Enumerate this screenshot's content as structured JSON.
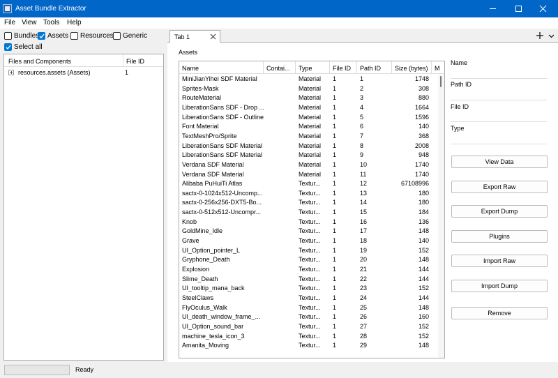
{
  "window": {
    "title": "Asset Bundle Extractor"
  },
  "menu": [
    "File",
    "View",
    "Tools",
    "Help"
  ],
  "filters": [
    {
      "label": "Bundles",
      "checked": false
    },
    {
      "label": "Assets",
      "checked": true
    },
    {
      "label": "Resources",
      "checked": false
    },
    {
      "label": "Generic",
      "checked": false
    }
  ],
  "select_all": {
    "label": "Select all",
    "checked": true
  },
  "left_panel": {
    "columns": [
      "Files and Components",
      "File ID"
    ],
    "rows": [
      {
        "name": "resources.assets (Assets)",
        "file_id": "1"
      }
    ]
  },
  "tabs": [
    {
      "label": "Tab 1"
    }
  ],
  "assets_label": "Assets",
  "table": {
    "columns": [
      "Name",
      "Contai...",
      "Type",
      "File ID",
      "Path ID",
      "Size (bytes)",
      "M"
    ],
    "rows": [
      [
        "MiniJianYihei SDF Material",
        "",
        "Material",
        "1",
        "1",
        "1748"
      ],
      [
        "Sprites-Mask",
        "",
        "Material",
        "1",
        "2",
        "308"
      ],
      [
        "RouteMaterial",
        "",
        "Material",
        "1",
        "3",
        "880"
      ],
      [
        "LiberationSans SDF - Drop ...",
        "",
        "Material",
        "1",
        "4",
        "1664"
      ],
      [
        "LiberationSans SDF - Outline",
        "",
        "Material",
        "1",
        "5",
        "1596"
      ],
      [
        "Font Material",
        "",
        "Material",
        "1",
        "6",
        "140"
      ],
      [
        "TextMeshPro/Sprite",
        "",
        "Material",
        "1",
        "7",
        "368"
      ],
      [
        "LiberationSans SDF Material",
        "",
        "Material",
        "1",
        "8",
        "2008"
      ],
      [
        "LiberationSans SDF Material",
        "",
        "Material",
        "1",
        "9",
        "948"
      ],
      [
        "Verdana SDF Material",
        "",
        "Material",
        "1",
        "10",
        "1740"
      ],
      [
        "Verdana SDF Material",
        "",
        "Material",
        "1",
        "11",
        "1740"
      ],
      [
        "Alibaba PuHuiTi Atlas",
        "",
        "Textur...",
        "1",
        "12",
        "67108996"
      ],
      [
        "sactx-0-1024x512-Uncomp...",
        "",
        "Textur...",
        "1",
        "13",
        "180"
      ],
      [
        "sactx-0-256x256-DXT5-Bo...",
        "",
        "Textur...",
        "1",
        "14",
        "180"
      ],
      [
        "sactx-0-512x512-Uncompr...",
        "",
        "Textur...",
        "1",
        "15",
        "184"
      ],
      [
        "Knob",
        "",
        "Textur...",
        "1",
        "16",
        "136"
      ],
      [
        "GoldMine_Idle",
        "",
        "Textur...",
        "1",
        "17",
        "148"
      ],
      [
        "Grave",
        "",
        "Textur...",
        "1",
        "18",
        "140"
      ],
      [
        "UI_Option_pointer_L",
        "",
        "Textur...",
        "1",
        "19",
        "152"
      ],
      [
        "Gryphone_Death",
        "",
        "Textur...",
        "1",
        "20",
        "148"
      ],
      [
        "Explosion",
        "",
        "Textur...",
        "1",
        "21",
        "144"
      ],
      [
        "Slime_Death",
        "",
        "Textur...",
        "1",
        "22",
        "144"
      ],
      [
        "UI_tooltip_mana_back",
        "",
        "Textur...",
        "1",
        "23",
        "152"
      ],
      [
        "SteelClaws",
        "",
        "Textur...",
        "1",
        "24",
        "144"
      ],
      [
        "FlyOculus_Walk",
        "",
        "Textur...",
        "1",
        "25",
        "148"
      ],
      [
        "UI_death_window_frame_...",
        "",
        "Textur...",
        "1",
        "26",
        "160"
      ],
      [
        "UI_Option_sound_bar",
        "",
        "Textur...",
        "1",
        "27",
        "152"
      ],
      [
        "machine_tesla_icon_3",
        "",
        "Textur...",
        "1",
        "28",
        "152"
      ],
      [
        "Amanita_Moving",
        "",
        "Textur...",
        "1",
        "29",
        "148"
      ]
    ]
  },
  "info_fields": [
    "Name",
    "Path ID",
    "File ID",
    "Type"
  ],
  "actions": [
    "View Data",
    "Export Raw",
    "Export Dump",
    "Plugins",
    "Import Raw",
    "Import Dump",
    "Remove"
  ],
  "status": "Ready",
  "icons": {
    "app": "app-icon",
    "minimize": "minimize-icon",
    "maximize": "maximize-icon",
    "close": "close-icon",
    "tab_close": "close-icon",
    "tab_add": "plus-icon",
    "tab_menu": "chevron-down-icon",
    "checkmark": "check-icon",
    "expander": "expand-plus-icon"
  },
  "colors": {
    "titlebar": "#0066c8",
    "check": "#0078d4"
  }
}
